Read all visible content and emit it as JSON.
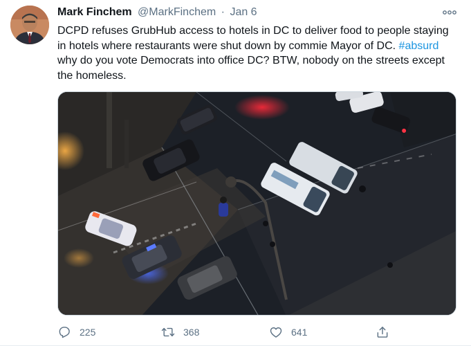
{
  "tweet": {
    "author": {
      "display_name": "Mark Finchem",
      "handle": "@MarkFinchem",
      "separator": "·",
      "date": "Jan 6"
    },
    "text": {
      "part1": "DCPD refuses GrubHub access to hotels in DC to deliver food to people staying in hotels where restaurants were shut down by commie Mayor of DC.",
      "hashtag": "#absurd",
      "part2": "why do you vote Democrats into office DC? BTW, nobody on the streets except the homeless."
    },
    "icons": {
      "more": "more-options-icon",
      "reply": "reply-icon",
      "retweet": "retweet-icon",
      "like": "like-icon",
      "share": "share-icon"
    },
    "actions": {
      "replies": "225",
      "retweets": "368",
      "likes": "641"
    },
    "colors": {
      "text": "#0f1419",
      "secondary": "#5b7083",
      "hashtag": "#1b95e0"
    }
  }
}
